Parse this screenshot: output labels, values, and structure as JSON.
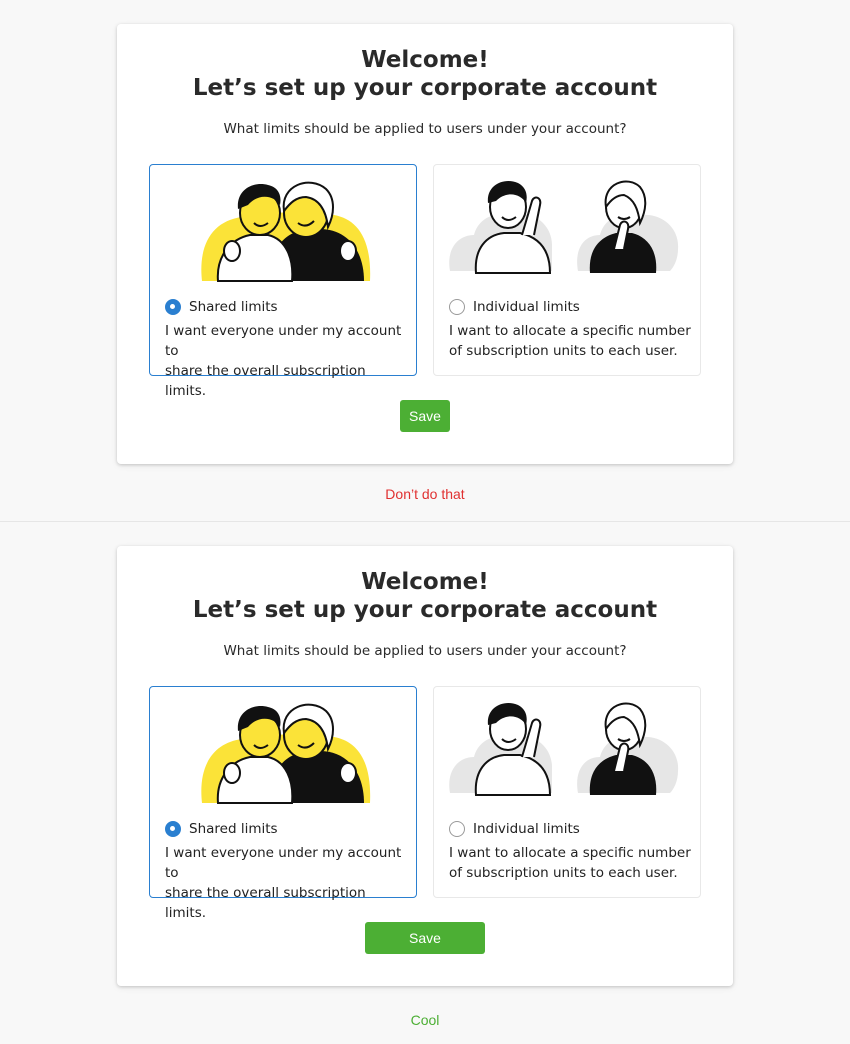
{
  "colors": {
    "accent": "#2a7fd0",
    "save": "#4caf34",
    "bad": "#e03131",
    "good": "#4caf34",
    "highlight": "#fbe338"
  },
  "examples": [
    {
      "title_line1": "Welcome!",
      "title_line2": "Let’s set up your corporate account",
      "question": "What limits should be applied to users under your account?",
      "options": [
        {
          "label": "Shared limits",
          "description_line1": "I want everyone under my account to",
          "description_line2": "share the overall subscription limits.",
          "selected": true,
          "icon": "two-people-hug-illustration"
        },
        {
          "label": "Individual limits",
          "description_line1": "I want to allocate a specific number",
          "description_line2": "of subscription units to each user.",
          "selected": false,
          "icon": "two-people-separate-illustration"
        }
      ],
      "save_label": "Save",
      "caption": "Don’t do that"
    },
    {
      "title_line1": "Welcome!",
      "title_line2": "Let’s set up your corporate account",
      "question": "What limits should be applied to users under your account?",
      "options": [
        {
          "label": "Shared limits",
          "description_line1": "I want everyone under my account to",
          "description_line2": "share the overall subscription limits.",
          "selected": true,
          "icon": "two-people-hug-illustration"
        },
        {
          "label": "Individual limits",
          "description_line1": "I want to allocate a specific number",
          "description_line2": "of subscription units to each user.",
          "selected": false,
          "icon": "two-people-separate-illustration"
        }
      ],
      "save_label": "Save",
      "caption": "Cool"
    }
  ]
}
